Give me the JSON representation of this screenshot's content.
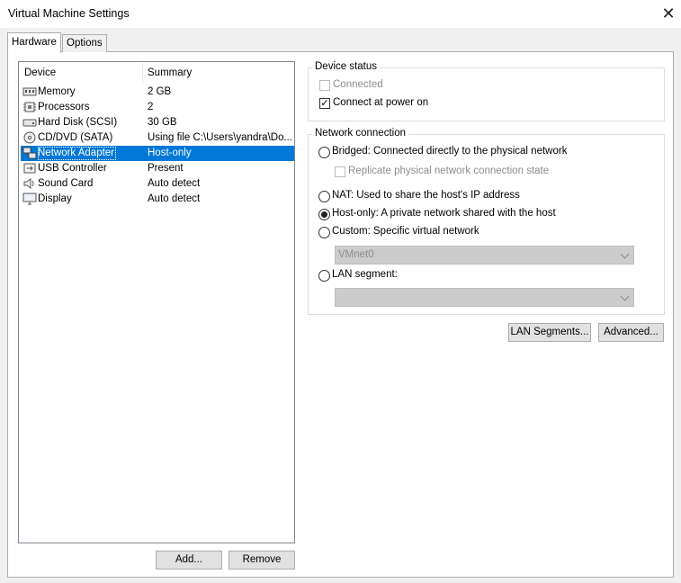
{
  "window": {
    "title": "Virtual Machine Settings",
    "close_glyph": "✕"
  },
  "tabs": {
    "hardware": "Hardware",
    "options": "Options"
  },
  "device_list": {
    "col_device": "Device",
    "col_summary": "Summary",
    "rows": [
      {
        "icon": "memory-icon",
        "name": "Memory",
        "summary": "2 GB"
      },
      {
        "icon": "processor-icon",
        "name": "Processors",
        "summary": "2"
      },
      {
        "icon": "hard-disk-icon",
        "name": "Hard Disk (SCSI)",
        "summary": "30 GB"
      },
      {
        "icon": "cd-dvd-icon",
        "name": "CD/DVD (SATA)",
        "summary": "Using file C:\\Users\\yandra\\Do..."
      },
      {
        "icon": "network-adapter-icon",
        "name": "Network Adapter",
        "summary": "Host-only",
        "selected": true
      },
      {
        "icon": "usb-icon",
        "name": "USB Controller",
        "summary": "Present"
      },
      {
        "icon": "sound-icon",
        "name": "Sound Card",
        "summary": "Auto detect"
      },
      {
        "icon": "display-icon",
        "name": "Display",
        "summary": "Auto detect"
      }
    ]
  },
  "buttons": {
    "add": "Add...",
    "remove": "Remove",
    "lan_segments": "LAN Segments...",
    "advanced": "Advanced..."
  },
  "device_status": {
    "label": "Device status",
    "connected": {
      "label": "Connected",
      "checked": false,
      "enabled": false
    },
    "connect_at_power_on": {
      "label": "Connect at power on",
      "checked": true
    }
  },
  "network_connection": {
    "label": "Network connection",
    "bridged": "Bridged: Connected directly to the physical network",
    "replicate": "Replicate physical network connection state",
    "nat": "NAT: Used to share the host's IP address",
    "host_only": "Host-only: A private network shared with the host",
    "custom": "Custom: Specific virtual network",
    "custom_value": "VMnet0",
    "lan_segment": "LAN segment:",
    "lan_segment_value": "",
    "selected": "host_only"
  }
}
